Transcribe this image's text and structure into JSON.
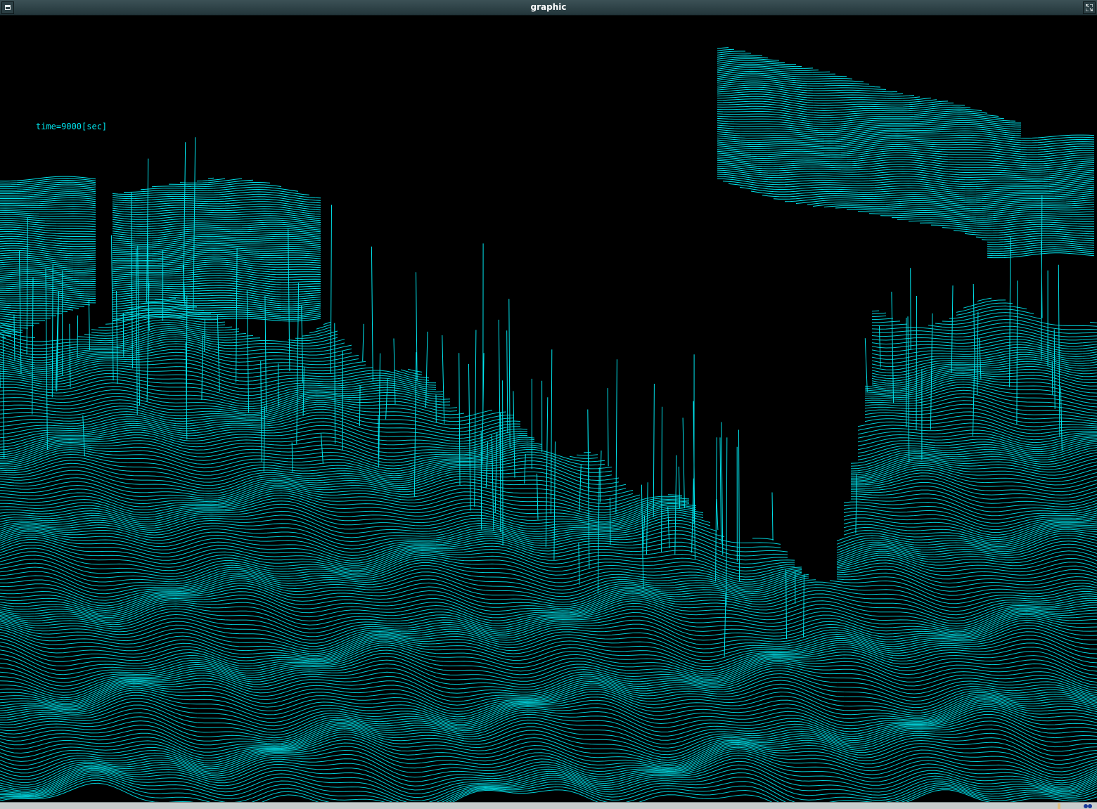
{
  "window": {
    "title": "graphic"
  },
  "plot": {
    "time_label": "time=9000[sec]",
    "line_color": "#00e5ee",
    "background_color": "#000000"
  },
  "icons": {
    "menu": "window-menu-icon",
    "maximize": "maximize-icon",
    "tray": "tray-icon"
  }
}
